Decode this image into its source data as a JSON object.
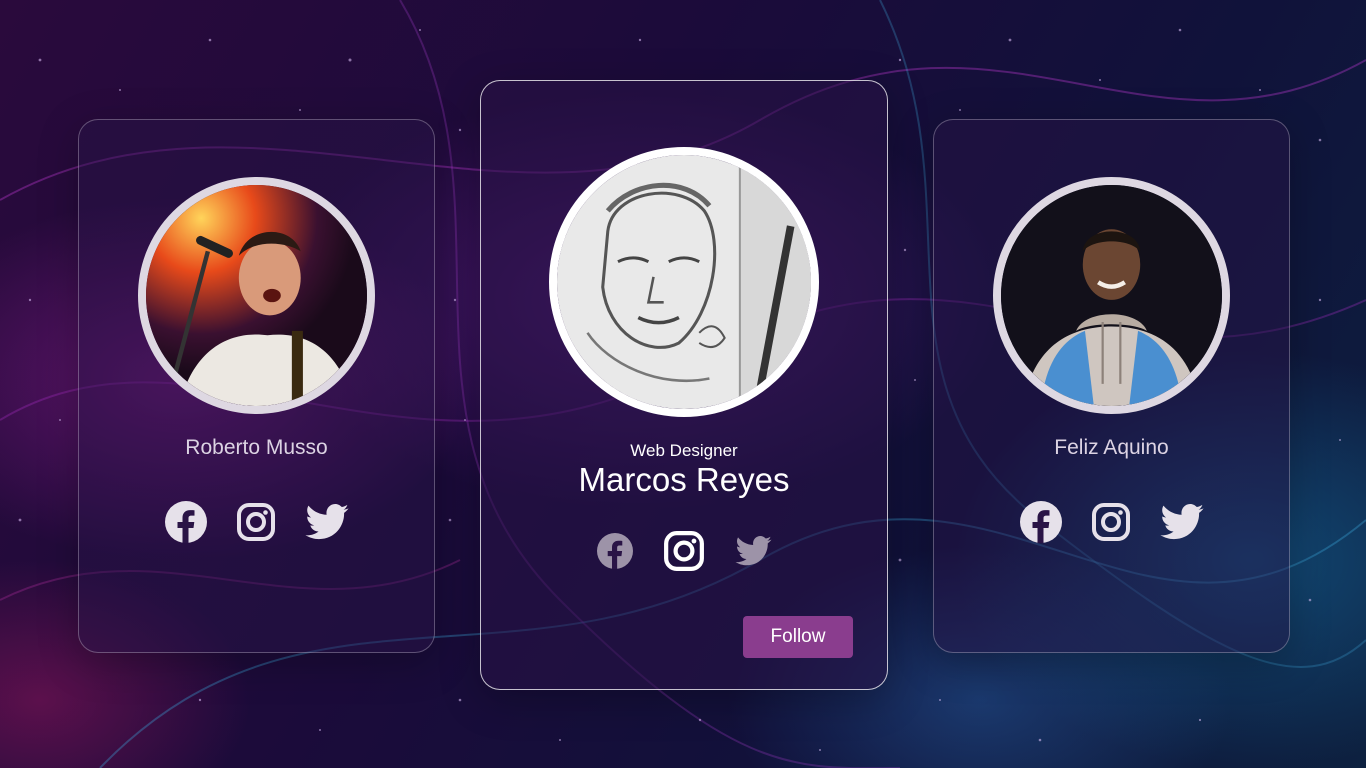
{
  "profiles": [
    {
      "name": "Roberto Musso",
      "socials": [
        "facebook-icon",
        "instagram-icon",
        "twitter-icon"
      ]
    },
    {
      "role": "Web Designer",
      "name": "Marcos Reyes",
      "socials": [
        "facebook-icon",
        "instagram-icon",
        "twitter-icon"
      ],
      "follow_label": "Follow"
    },
    {
      "name": "Feliz Aquino",
      "socials": [
        "facebook-icon",
        "instagram-icon",
        "twitter-icon"
      ]
    }
  ],
  "colors": {
    "follow_button": "#8a3d8e",
    "icon_active": "#ffffff",
    "icon_dim": "#b9b2c2",
    "name_text": "#dcd3e3"
  }
}
